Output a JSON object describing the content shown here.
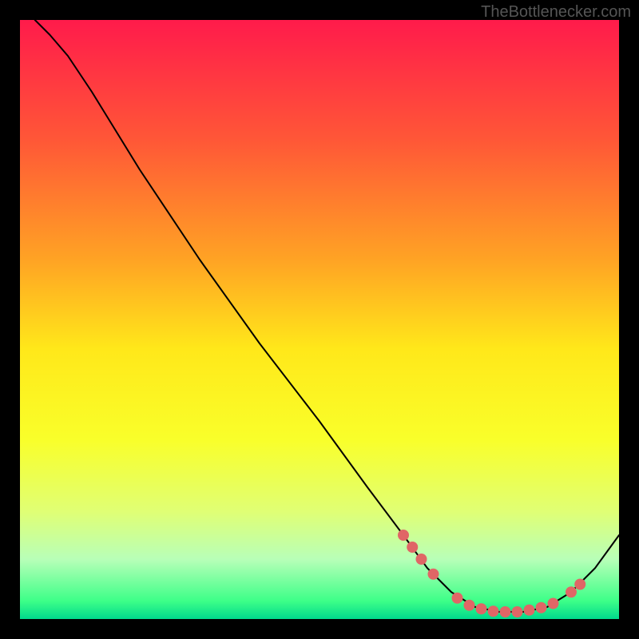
{
  "watermark": "TheBottlenecker.com",
  "chart_data": {
    "type": "line",
    "title": "",
    "xlabel": "",
    "ylabel": "",
    "xlim": [
      0,
      100
    ],
    "ylim": [
      0,
      100
    ],
    "background_gradient": {
      "stops": [
        {
          "pos": 0.0,
          "color": "#ff1b4b"
        },
        {
          "pos": 0.2,
          "color": "#ff5737"
        },
        {
          "pos": 0.4,
          "color": "#ffa324"
        },
        {
          "pos": 0.55,
          "color": "#ffe81a"
        },
        {
          "pos": 0.7,
          "color": "#f9ff2a"
        },
        {
          "pos": 0.82,
          "color": "#e0ff74"
        },
        {
          "pos": 0.9,
          "color": "#b8ffb8"
        },
        {
          "pos": 0.97,
          "color": "#3dff88"
        },
        {
          "pos": 1.0,
          "color": "#00d98c"
        }
      ]
    },
    "series": [
      {
        "name": "bottleneck-curve",
        "color": "#000000",
        "stroke_width": 2,
        "points": [
          {
            "x": 2.5,
            "y": 100.0
          },
          {
            "x": 5.0,
            "y": 97.5
          },
          {
            "x": 8.0,
            "y": 94.0
          },
          {
            "x": 12.0,
            "y": 88.0
          },
          {
            "x": 20.0,
            "y": 75.0
          },
          {
            "x": 30.0,
            "y": 60.0
          },
          {
            "x": 40.0,
            "y": 46.0
          },
          {
            "x": 50.0,
            "y": 33.0
          },
          {
            "x": 58.0,
            "y": 22.0
          },
          {
            "x": 64.0,
            "y": 14.0
          },
          {
            "x": 68.0,
            "y": 8.5
          },
          {
            "x": 72.0,
            "y": 4.5
          },
          {
            "x": 76.0,
            "y": 2.0
          },
          {
            "x": 80.0,
            "y": 1.2
          },
          {
            "x": 84.0,
            "y": 1.2
          },
          {
            "x": 88.0,
            "y": 2.0
          },
          {
            "x": 92.0,
            "y": 4.5
          },
          {
            "x": 96.0,
            "y": 8.5
          },
          {
            "x": 100.0,
            "y": 14.0
          }
        ]
      }
    ],
    "markers": {
      "name": "curve-markers",
      "color": "#e06666",
      "radius": 7,
      "points": [
        {
          "x": 64.0,
          "y": 14.0
        },
        {
          "x": 65.5,
          "y": 12.0
        },
        {
          "x": 67.0,
          "y": 10.0
        },
        {
          "x": 69.0,
          "y": 7.5
        },
        {
          "x": 73.0,
          "y": 3.5
        },
        {
          "x": 75.0,
          "y": 2.3
        },
        {
          "x": 77.0,
          "y": 1.7
        },
        {
          "x": 79.0,
          "y": 1.3
        },
        {
          "x": 81.0,
          "y": 1.2
        },
        {
          "x": 83.0,
          "y": 1.2
        },
        {
          "x": 85.0,
          "y": 1.5
        },
        {
          "x": 87.0,
          "y": 1.9
        },
        {
          "x": 89.0,
          "y": 2.6
        },
        {
          "x": 92.0,
          "y": 4.5
        },
        {
          "x": 93.5,
          "y": 5.8
        }
      ]
    }
  }
}
